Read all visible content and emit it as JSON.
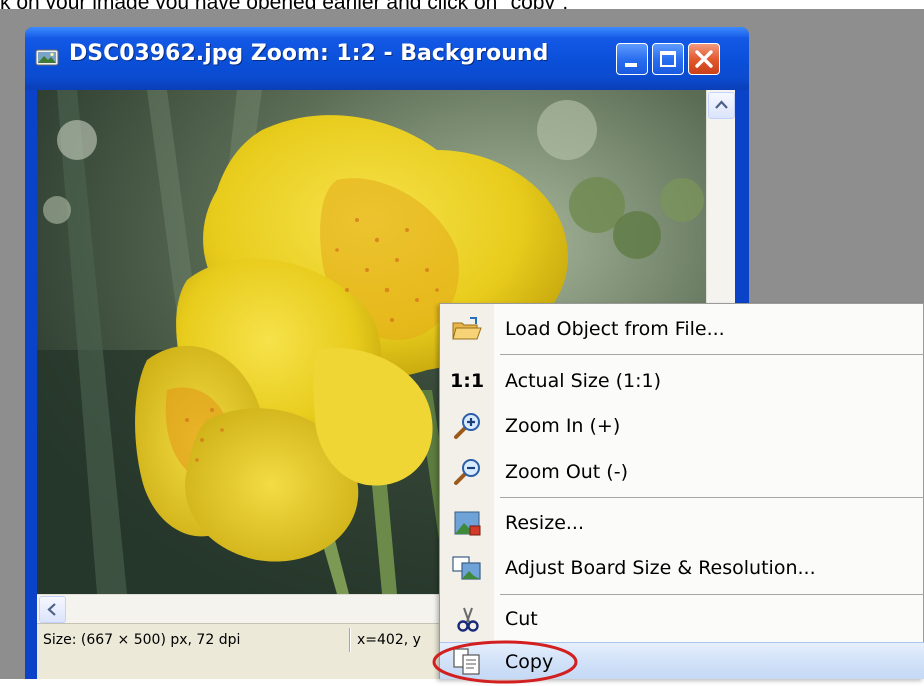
{
  "instruction": {
    "text": "k on your image you have opened earlier and click on \"copy\":"
  },
  "window": {
    "title": "DSC03962.jpg  Zoom: 1:2 - Background",
    "minimize_icon": "minimize-icon",
    "maximize_icon": "maximize-icon",
    "close_icon": "close-icon"
  },
  "status_bar": {
    "size_text": "Size: (667 × 500) px, 72 dpi",
    "coords_text": "x=402, y"
  },
  "context_menu": {
    "items": [
      {
        "label": "Load Object from File...",
        "icon": "open-folder-icon"
      },
      {
        "label": "Actual Size (1:1)",
        "icon": "actual-size-icon",
        "icon_text": "1:1"
      },
      {
        "label": "Zoom In (+)",
        "icon": "zoom-in-icon"
      },
      {
        "label": "Zoom Out (-)",
        "icon": "zoom-out-icon"
      },
      {
        "label": "Resize...",
        "icon": "resize-icon"
      },
      {
        "label": "Adjust Board Size & Resolution...",
        "icon": "board-size-icon"
      },
      {
        "label": "Cut",
        "icon": "scissors-icon"
      },
      {
        "label": "Copy",
        "icon": "copy-icon",
        "highlighted": true
      }
    ]
  },
  "annotation": {
    "highlight_color": "#d22020"
  },
  "colors": {
    "titlebar": "#0b4bd0",
    "menu_highlight": "#d2e2f8",
    "window_frame": "#0a43c8"
  }
}
